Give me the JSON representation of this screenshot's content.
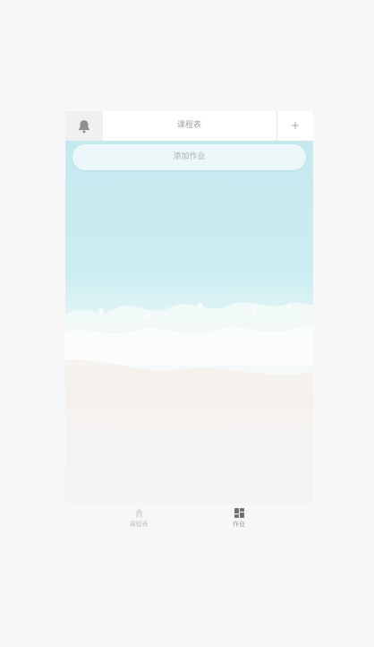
{
  "header": {
    "title": "课程表",
    "add_label": "+",
    "bell_icon": "bell-icon"
  },
  "main": {
    "add_homework_label": "添加作业"
  },
  "tabbar": {
    "tabs": [
      {
        "label": "课程表",
        "icon": "home-icon"
      },
      {
        "label": "作业",
        "icon": "grid-icon"
      }
    ]
  },
  "colors": {
    "background": "#f7f7f7",
    "sea": "#cdeef2",
    "sand": "#f5f2ef",
    "muted_text": "#a3a3a3"
  }
}
